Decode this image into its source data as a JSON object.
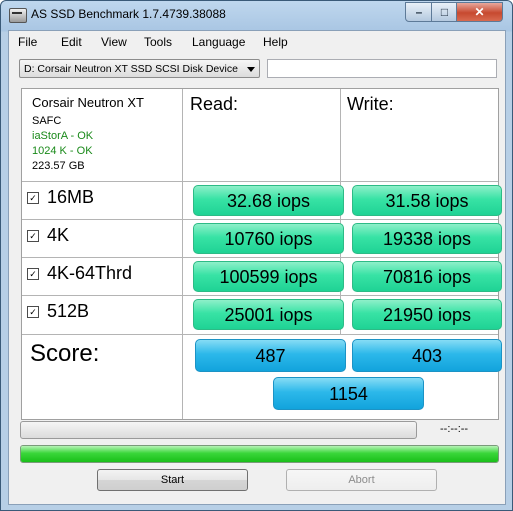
{
  "window": {
    "title": "AS SSD Benchmark 1.7.4739.38088"
  },
  "menu": [
    "File",
    "Edit",
    "View",
    "Tools",
    "Language",
    "Help"
  ],
  "drive_select": {
    "value": "D: Corsair Neutron XT SSD SCSI Disk Device"
  },
  "drive_info": {
    "name": "Corsair Neutron XT",
    "firmware": "SAFC",
    "driver": "iaStorA - OK",
    "alignment": "1024 K - OK",
    "size": "223.57 GB",
    "ok_color": "#1a8a1a"
  },
  "headers": {
    "read": "Read:",
    "write": "Write:"
  },
  "tests": [
    {
      "label": "16MB",
      "checked": true,
      "read": "32.68 iops",
      "write": "31.58 iops"
    },
    {
      "label": "4K",
      "checked": true,
      "read": "10760 iops",
      "write": "19338 iops"
    },
    {
      "label": "4K-64Thrd",
      "checked": true,
      "read": "100599 iops",
      "write": "70816 iops"
    },
    {
      "label": "512B",
      "checked": true,
      "read": "25001 iops",
      "write": "21950 iops"
    }
  ],
  "score": {
    "label": "Score:",
    "read": "487",
    "write": "403",
    "total": "1154"
  },
  "progress": {
    "time": "--:--:--",
    "main_fraction": 1.0,
    "sub_fraction": 0
  },
  "buttons": {
    "start": "Start",
    "abort": "Abort"
  },
  "colors": {
    "result_green": "#2ee0a0",
    "score_blue": "#1eb0e6",
    "progress_green": "#2cd42c"
  }
}
